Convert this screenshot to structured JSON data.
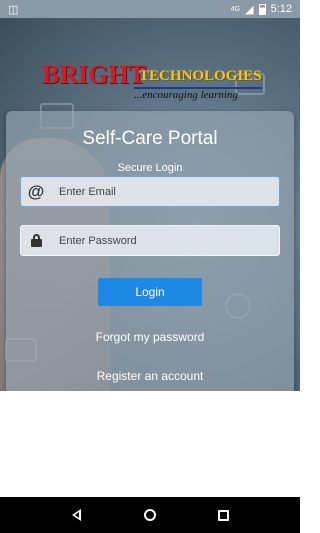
{
  "status": {
    "network": "4G",
    "time": "5:12"
  },
  "logo": {
    "brand": "BRIGHT",
    "brand2": "TECHNOLOGIES",
    "tagline": "...encouraging learning"
  },
  "login": {
    "title": "Self-Care Portal",
    "subtitle": "Secure Login",
    "email_placeholder": "Enter Email",
    "password_placeholder": "Enter Password",
    "login_label": "Login",
    "forgot_label": "Forgot my password",
    "register_label": "Register an account"
  },
  "colors": {
    "accent": "#1e88e5",
    "brand_red": "#c8202b",
    "brand_gold": "#f1c232"
  },
  "icons": [
    "at-sign-icon",
    "lock-icon",
    "back-icon",
    "home-icon",
    "recents-icon"
  ]
}
